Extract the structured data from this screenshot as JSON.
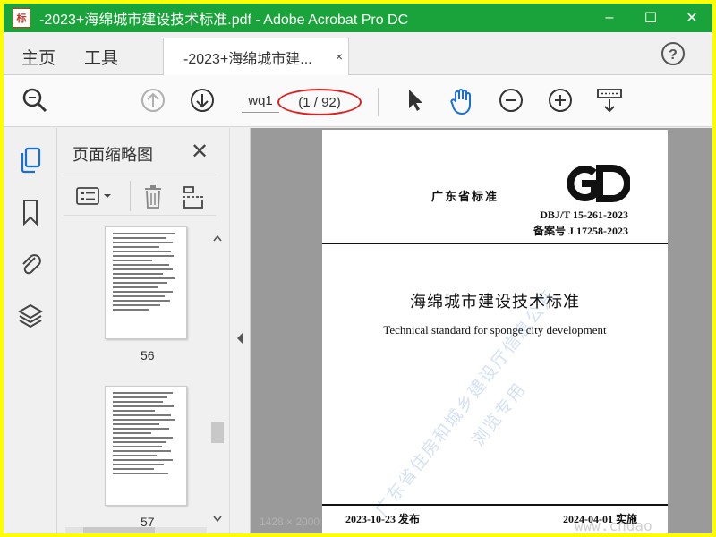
{
  "window": {
    "icon_text": "标",
    "title": "-2023+海绵城市建设技术标准.pdf - Adobe Acrobat Pro DC",
    "controls": [
      "–",
      "☐",
      "✕"
    ]
  },
  "tabs": {
    "home": "主页",
    "tools": "工具",
    "document": "-2023+海绵城市建...",
    "document_close": "×",
    "help": "?"
  },
  "toolbar": {
    "page_input_value": "wq1",
    "page_count": "(1 / 92)",
    "icons": [
      "zoom-search-icon",
      "page-up-icon",
      "page-down-icon",
      "select-arrow-icon",
      "hand-tool-icon",
      "zoom-out-icon",
      "zoom-in-icon",
      "keyboard-scroll-icon"
    ],
    "accent": "#1a6fd6",
    "highlight_color": "#e02020"
  },
  "thumbnails_panel": {
    "title": "页面缩略图",
    "close": "✕",
    "pages": [
      {
        "label": "56"
      },
      {
        "label": "57"
      }
    ]
  },
  "document": {
    "province": "广东省标准",
    "logo": "GD",
    "standard_code": "DBJ/T 15-261-2023",
    "record_number": "备案号 J 17258-2023",
    "title_cn": "海绵城市建设技术标准",
    "title_en": "Technical standard for sponge city development",
    "watermark_1": "广东省住房和城乡建设厅信息公开",
    "watermark_2": "浏览专用",
    "issue_date": "2023-10-23  发布",
    "implement_date": "2024-04-01  实施"
  },
  "overlay": {
    "site_watermark": "www.cndao",
    "size_badge": "1428 × 2000"
  },
  "colors": {
    "titlebar": "#1aa33a",
    "border": "#ffff00"
  }
}
